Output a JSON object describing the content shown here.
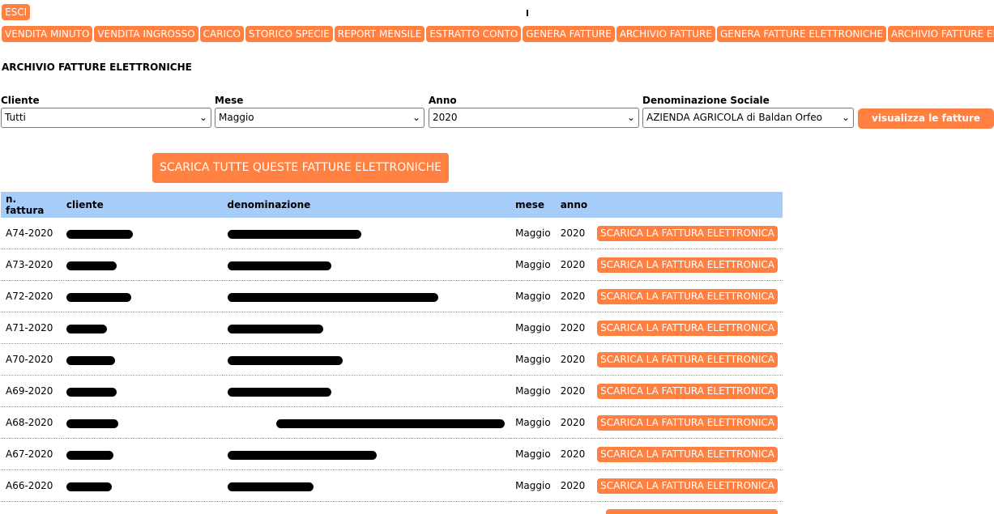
{
  "header": {
    "esci_label": "ESCI",
    "nav": [
      "VENDITA MINUTO",
      "VENDITA INGROSSO",
      "CARICO",
      "STORICO SPECIE",
      "REPORT MENSILE",
      "ESTRATTO CONTO",
      "GENERA FATTURE",
      "ARCHIVIO FATTURE",
      "GENERA FATTURE ELETTRONICHE",
      "ARCHIVIO FATTURE ELETTRONICHE"
    ]
  },
  "page_title": "ARCHIVIO FATTURE ELETTRONICHE",
  "filters": {
    "cliente": {
      "label": "Cliente",
      "value": "Tutti"
    },
    "mese": {
      "label": "Mese",
      "value": "Maggio"
    },
    "anno": {
      "label": "Anno",
      "value": "2020"
    },
    "denominazione": {
      "label": "Denominazione Sociale",
      "value": "AZIENDA AGRICOLA di Baldan Orfeo"
    }
  },
  "visualizza_label": "visualizza le fatture",
  "scarica_tutte_label": "SCARICA TUTTE QUESTE FATTURE ELETTRONICHE",
  "table": {
    "headers": [
      "n. fattura",
      "cliente",
      "denominazione",
      "mese",
      "anno"
    ],
    "row_button_label": "SCARICA LA FATTURA ELETTRONICA",
    "rows": [
      {
        "n": "A74-2020",
        "mese": "Maggio",
        "anno": "2020"
      },
      {
        "n": "A73-2020",
        "mese": "Maggio",
        "anno": "2020"
      },
      {
        "n": "A72-2020",
        "mese": "Maggio",
        "anno": "2020"
      },
      {
        "n": "A71-2020",
        "mese": "Maggio",
        "anno": "2020"
      },
      {
        "n": "A70-2020",
        "mese": "Maggio",
        "anno": "2020"
      },
      {
        "n": "A69-2020",
        "mese": "Maggio",
        "anno": "2020"
      },
      {
        "n": "A68-2020",
        "mese": "Maggio",
        "anno": "2020"
      },
      {
        "n": "A67-2020",
        "mese": "Maggio",
        "anno": "2020"
      },
      {
        "n": "A66-2020",
        "mese": "Maggio",
        "anno": "2020"
      }
    ]
  }
}
